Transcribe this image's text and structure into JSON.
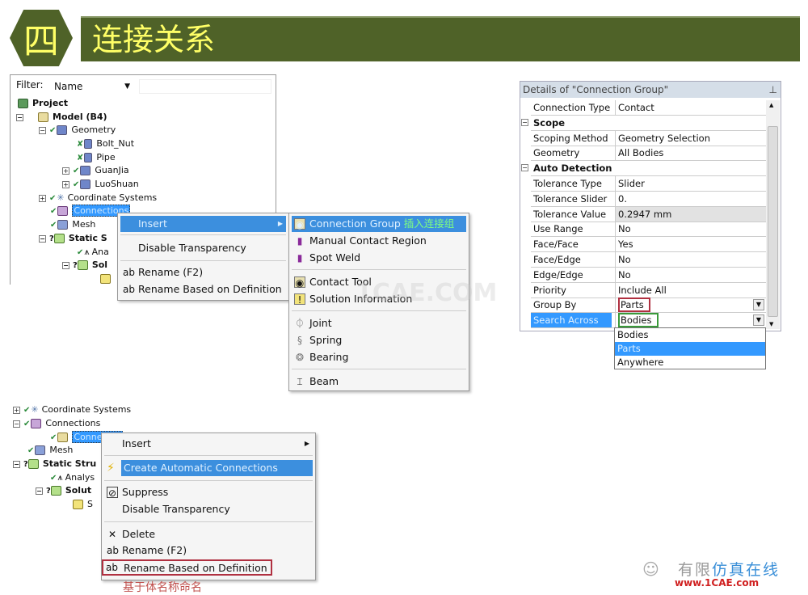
{
  "header": {
    "number": "四",
    "title": "连接关系",
    "color": "#4f6228",
    "text_color": "#ffff66"
  },
  "tree1": {
    "filter_label": "Filter:",
    "filter_value": "Name",
    "search_value": "",
    "items": [
      "Project",
      "Model (B4)",
      "Geometry",
      "Bolt_Nut",
      "Pipe",
      "GuanJia",
      "LuoShuan",
      "Coordinate Systems",
      "Connections",
      "Mesh",
      "Static S",
      "Ana",
      "Sol"
    ]
  },
  "menu1": {
    "items": [
      "Insert",
      "Disable Transparency",
      "Rename (F2)",
      "Rename Based on Definition"
    ]
  },
  "submenu": {
    "items": [
      "Connection Group",
      "Manual Contact Region",
      "Spot Weld",
      "Contact Tool",
      "Solution Information",
      "Joint",
      "Spring",
      "Bearing",
      "Beam"
    ],
    "annotation": "插入连接组"
  },
  "watermark": "1CAE.COM",
  "details": {
    "title": "Details of \"Connection Group\"",
    "rows": [
      {
        "label": "Connection Type",
        "value": "Contact"
      },
      {
        "label": "Scope",
        "group": true
      },
      {
        "label": "Scoping Method",
        "value": "Geometry Selection"
      },
      {
        "label": "Geometry",
        "value": "All Bodies"
      },
      {
        "label": "Auto Detection",
        "group": true
      },
      {
        "label": "Tolerance Type",
        "value": "Slider"
      },
      {
        "label": "Tolerance Slider",
        "value": "0."
      },
      {
        "label": "Tolerance Value",
        "value": "0.2947 mm"
      },
      {
        "label": "Use Range",
        "value": "No"
      },
      {
        "label": "Face/Face",
        "value": "Yes"
      },
      {
        "label": "Face/Edge",
        "value": "No"
      },
      {
        "label": "Edge/Edge",
        "value": "No"
      },
      {
        "label": "Priority",
        "value": "Include All"
      },
      {
        "label": "Group By",
        "value": "Parts"
      },
      {
        "label": "Search Across",
        "value": "Bodies"
      }
    ],
    "dropdown_options": [
      "Bodies",
      "Parts",
      "Anywhere"
    ],
    "dropdown_highlighted": "Parts"
  },
  "tree2": {
    "items": [
      "Coordinate Systems",
      "Connections",
      "Conne",
      "Mesh",
      "Static Stru",
      "Analys",
      "Solut",
      "S"
    ]
  },
  "menu2": {
    "items": [
      "Insert",
      "Create Automatic Connections",
      "Suppress",
      "Disable Transparency",
      "Delete",
      "Rename (F2)",
      "Rename Based on Definition"
    ],
    "annotation": "基于体名称命名"
  },
  "logo": {
    "text_cn": "有限元仿真在线",
    "url_text": "www.1CAE.com"
  }
}
